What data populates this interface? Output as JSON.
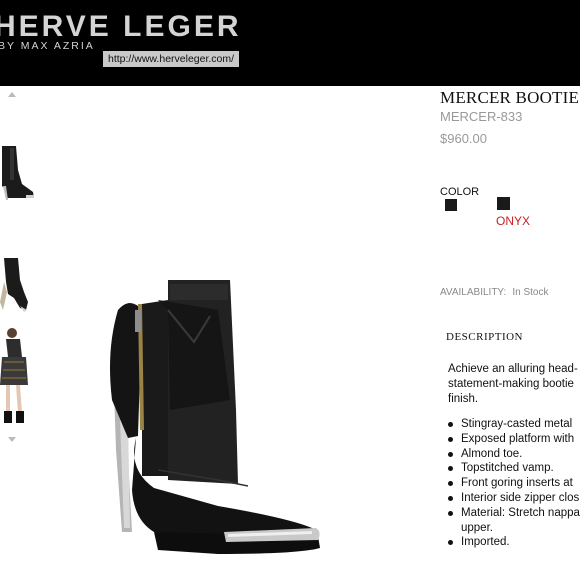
{
  "header": {
    "brand": "HERVE LEGER",
    "brand_sub": "BY MAX AZRIA",
    "url": "http://www.herveleger.com/"
  },
  "thumbnails": [
    {
      "name": "bootie-side-view",
      "icon": "boot-thumbnail"
    },
    {
      "name": "bootie-angle-view",
      "icon": "boot-thumbnail"
    },
    {
      "name": "model-wearing-dress",
      "icon": "model-thumbnail"
    }
  ],
  "product": {
    "title": "MERCER BOOTIE",
    "sku": "MERCER-833",
    "price": "$960.00",
    "color_label": "COLOR",
    "color_name": "ONYX",
    "availability_label": "AVAILABILITY:",
    "availability_value": "In Stock",
    "description_label": "DESCRIPTION",
    "description_lines": [
      "Achieve an alluring head-",
      "statement-making bootie",
      "finish."
    ],
    "features": [
      "Stingray-casted metal",
      "Exposed platform with",
      "Almond toe.",
      "Topstitched vamp.",
      "Front goring inserts at",
      "Interior side zipper clos",
      "Material: Stretch nappa",
      "upper.",
      "Imported."
    ]
  },
  "colors": {
    "header_bg": "#000000",
    "swatch": "#1a1a1a",
    "color_name": "#cc1f1f",
    "muted_text": "#999999"
  }
}
